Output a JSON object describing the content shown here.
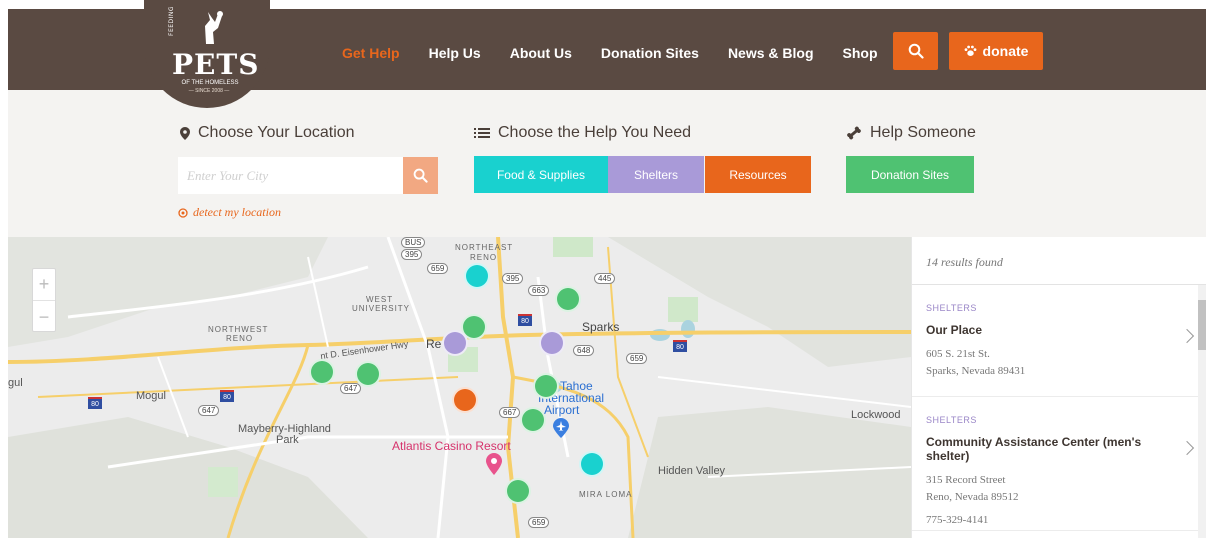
{
  "logo": {
    "top": "FEEDING",
    "name": "PETS",
    "sub": "OF THE HOMELESS",
    "since": "— SINCE 2008 —"
  },
  "nav": {
    "items": [
      {
        "label": "Get Help",
        "active": true
      },
      {
        "label": "Help Us"
      },
      {
        "label": "About Us"
      },
      {
        "label": "Donation Sites"
      },
      {
        "label": "News & Blog"
      },
      {
        "label": "Shop"
      }
    ],
    "donate_label": "donate"
  },
  "filters": {
    "location_title": "Choose Your Location",
    "city_placeholder": "Enter Your City",
    "detect_label": "detect my location",
    "help_title": "Choose the Help You Need",
    "help_buttons": [
      {
        "label": "Food & Supplies",
        "color": "#19d1cf"
      },
      {
        "label": "Shelters",
        "color": "#a99ad8"
      },
      {
        "label": "Resources",
        "color": "#e8661c"
      }
    ],
    "someone_title": "Help Someone",
    "donation_sites_label": "Donation Sites",
    "donation_color": "#4fc272"
  },
  "map": {
    "labels": {
      "northeast": "NORTHEAST",
      "reno_top": "RENO",
      "west": "WEST",
      "university": "UNIVERSITY",
      "northwest": "NORTHWEST",
      "nw_reno": "RENO",
      "sparks": "Sparks",
      "reno": "Re",
      "eisenhower": "nt D. Eisenhower Hwy",
      "mogul_left": "gul",
      "mogul": "Mogul",
      "mayberry": "Mayberry-Highland",
      "park": "Park",
      "atlantis": "Atlantis Casino Resort",
      "tahoe": "Tahoe",
      "international": "International",
      "airport": "Airport",
      "lockwood": "Lockwood",
      "hidden_valley": "Hidden Valley",
      "mira_loma": "MIRA LOMA"
    },
    "shields": [
      "BUS",
      "395",
      "659",
      "395",
      "663",
      "445",
      "80",
      "648",
      "659",
      "80",
      "647",
      "80",
      "647",
      "667",
      "80",
      "659"
    ]
  },
  "results": {
    "count_text": "14 results found",
    "items": [
      {
        "type": "SHELTERS",
        "name": "Our Place",
        "address1": "605 S. 21st St.",
        "address2": "Sparks, Nevada 89431",
        "phone": ""
      },
      {
        "type": "SHELTERS",
        "name": "Community Assistance Center (men's shelter)",
        "address1": "315 Record Street",
        "address2": "Reno, Nevada 89512",
        "phone": "775-329-4141"
      }
    ]
  },
  "colors": {
    "header": "#5a4a42",
    "accent": "#e8661c",
    "food": "#19d1cf",
    "shelter": "#a99ad8",
    "resource": "#e8661c",
    "donation": "#4fc272"
  }
}
